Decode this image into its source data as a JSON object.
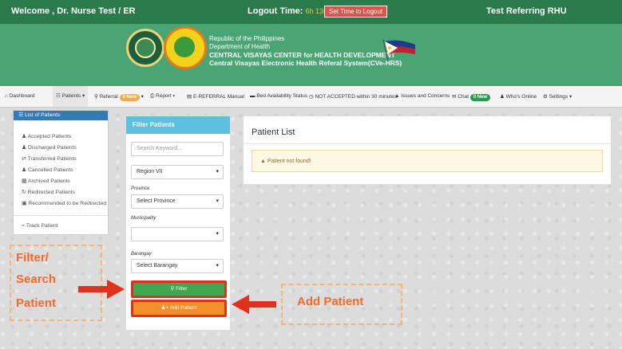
{
  "topbar": {
    "welcome": "Welcome , Dr. Nurse Test / ER",
    "logout_label": "Logout Time:",
    "logout_timer": "6h 13m 11s",
    "set_time_button": "Set Time to Logout",
    "facility": "Test Referring RHU"
  },
  "banner": {
    "line1": "Republic of the Philippines",
    "line2": "Department of Health",
    "line3": "CENTRAL VISAYAS CENTER for HEALTH DEVELOPMENT",
    "line4": "Central Visayas Electronic Health Referal System(CVe-HRS)"
  },
  "nav": {
    "dashboard": "Dashboard",
    "patients": "Patients",
    "referral": "Referral",
    "referral_badge": "0 New",
    "report": "Report",
    "manual": "E-REFERRAL Manual",
    "bed": "Bed Availability Status",
    "not_accepted": "NOT ACCEPTED within 30 minutes",
    "issues": "Issues and Concerns",
    "chat": "Chat",
    "chat_badge": "0 New",
    "whos_online": "Who's Online",
    "settings": "Settings"
  },
  "sidebar": {
    "items": [
      {
        "label": "List of Patients",
        "icon": "list-icon"
      },
      {
        "label": "Accepted Patients",
        "icon": "users-icon"
      },
      {
        "label": "Discharged Patients",
        "icon": "users-icon"
      },
      {
        "label": "Transferred Patients",
        "icon": "transfer-icon"
      },
      {
        "label": "Cancelled Patients",
        "icon": "users-icon"
      },
      {
        "label": "Archived Patients",
        "icon": "archive-icon"
      },
      {
        "label": "Redirected Patients",
        "icon": "redirect-icon"
      },
      {
        "label": "Recommended to be Redirected",
        "icon": "note-icon"
      },
      {
        "label": "Track Patient",
        "icon": "chart-icon"
      }
    ]
  },
  "filter": {
    "title": "Filter Patients",
    "search_placeholder": "Search Keyword...",
    "region_value": "Region VII",
    "province_label": "Province",
    "province_value": "Select Province",
    "municipality_label": "Municipality",
    "municipality_value": "",
    "barangay_label": "Barangay",
    "barangay_value": "Select Barangay",
    "filter_button": "Filter",
    "add_button": "Add Patient"
  },
  "list": {
    "title": "Patient List",
    "alert": "Patient not found!"
  },
  "annotations": {
    "filter_line1": "Filter/",
    "filter_line2": "Search",
    "filter_line3": "Patient",
    "add_patient": "Add Patient"
  },
  "colors": {
    "topbar": "#2b7a4b",
    "banner": "#4aa474",
    "filter_header": "#5bc0de",
    "filter_button": "#3ea84e",
    "add_button": "#f2902a",
    "annotation": "#f26a2a",
    "highlight_arrow": "#e0301e"
  }
}
